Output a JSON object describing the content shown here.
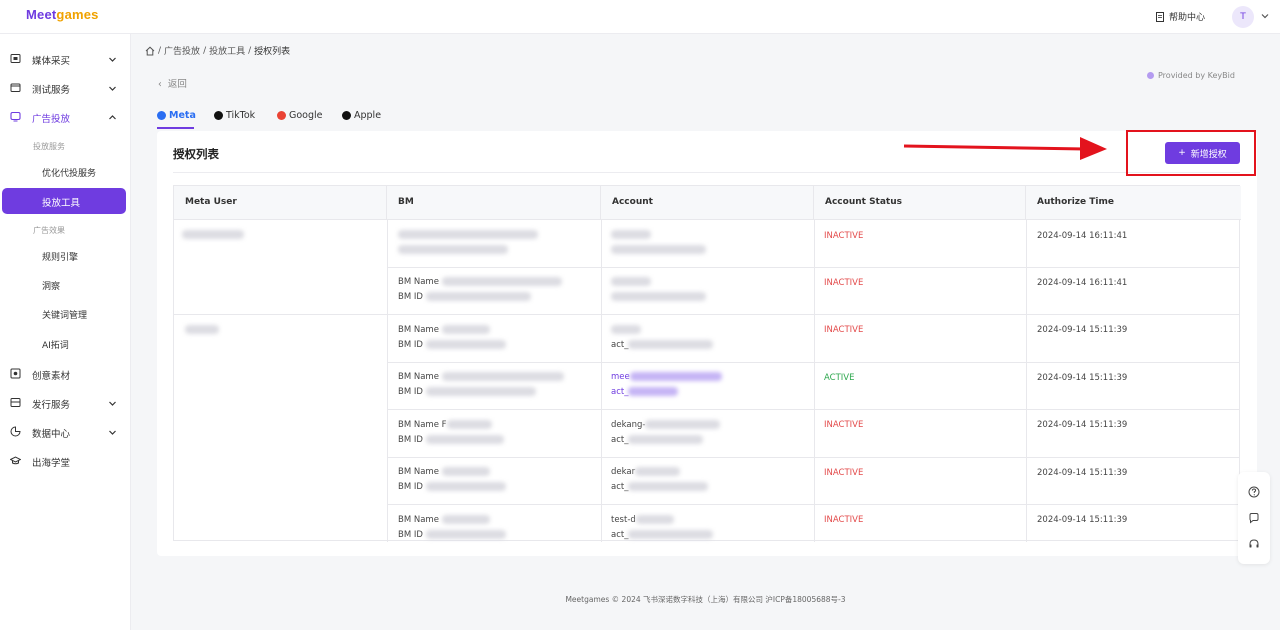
{
  "app": {
    "logo_main": "Meet",
    "logo_accent": "games",
    "help_label": "帮助中心",
    "avatar_initial": "T"
  },
  "sidebar": {
    "items": [
      {
        "label": "媒体采买",
        "icon": "media-icon"
      },
      {
        "label": "测试服务",
        "icon": "test-icon"
      },
      {
        "label": "广告投放",
        "icon": "ads-icon"
      },
      {
        "label": "创意素材",
        "icon": "creative-icon"
      },
      {
        "label": "发行服务",
        "icon": "publish-icon"
      },
      {
        "label": "数据中心",
        "icon": "data-icon"
      },
      {
        "label": "出海学堂",
        "icon": "school-icon"
      }
    ],
    "groups": {
      "delivery_service": "投放服务",
      "ad_effect": "广告效果"
    },
    "sub_items": {
      "optimize": "优化代投服务",
      "tools": "投放工具",
      "rules": "规则引擎",
      "insight": "洞察",
      "keywords": "关键词管理",
      "ai": "AI拓词"
    }
  },
  "breadcrumb": {
    "items": [
      "广告投放",
      "投放工具",
      "授权列表"
    ]
  },
  "back_label": "返回",
  "provided_by": "Provided by KeyBid",
  "tabs": [
    {
      "label": "Meta",
      "color": "#2a6ef2",
      "active": true
    },
    {
      "label": "TikTok",
      "color": "#111111",
      "active": false
    },
    {
      "label": "Google",
      "color": "#ea4335",
      "active": false
    },
    {
      "label": "Apple",
      "color": "#111111",
      "active": false
    }
  ],
  "card": {
    "title": "授权列表",
    "add_button": "新增授权"
  },
  "table": {
    "headers": [
      "Meta User",
      "BM",
      "Account",
      "Account Status",
      "Authorize Time"
    ],
    "bm_name_label": "BM Name",
    "bm_id_label": "BM ID",
    "rows": [
      {
        "bm_name_prefix": "",
        "bm_id_prefix": "",
        "account_line1": "",
        "account_line2": "",
        "status": "INACTIVE",
        "time": "2024-09-14 16:11:41"
      },
      {
        "bm_name_prefix": "BM Name",
        "bm_id_prefix": "BM ID",
        "account_line1": "",
        "account_line2": "",
        "status": "INACTIVE",
        "time": "2024-09-14 16:11:41"
      },
      {
        "bm_name_prefix": "BM Name",
        "bm_id_prefix": "BM ID",
        "account_line1": "",
        "account_line2": "act_",
        "status": "INACTIVE",
        "time": "2024-09-14 15:11:39"
      },
      {
        "bm_name_prefix": "BM Name",
        "bm_id_prefix": "BM ID",
        "account_line1": "mee",
        "account_line2": "act_",
        "status": "ACTIVE",
        "time": "2024-09-14 15:11:39"
      },
      {
        "bm_name_prefix": "BM Name F",
        "bm_id_prefix": "BM ID",
        "account_line1": "dekang-",
        "account_line2": "act_",
        "status": "INACTIVE",
        "time": "2024-09-14 15:11:39"
      },
      {
        "bm_name_prefix": "BM Name",
        "bm_id_prefix": "BM ID",
        "account_line1": "dekar",
        "account_line2": "act_",
        "status": "INACTIVE",
        "time": "2024-09-14 15:11:39"
      },
      {
        "bm_name_prefix": "BM Name",
        "bm_id_prefix": "BM ID",
        "account_line1": "test-d",
        "account_line2": "act_",
        "status": "INACTIVE",
        "time": "2024-09-14 15:11:39"
      }
    ]
  },
  "footer": "Meetgames © 2024 飞书深诺数字科技（上海）有限公司 沪ICP备18005688号-3",
  "colors": {
    "brand": "#6f3ce0",
    "inactive": "#e34a4a",
    "active": "#2fa84f",
    "highlight": "#e3131d"
  }
}
